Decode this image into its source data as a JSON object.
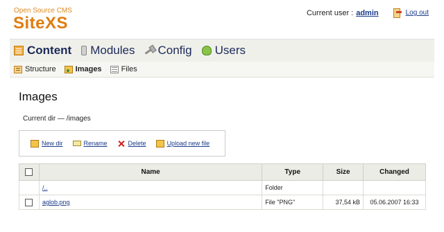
{
  "brand": {
    "tagline": "Open Source CMS",
    "name": "SiteXS"
  },
  "user": {
    "label": "Current user :",
    "name": "admin",
    "logout": "Log out"
  },
  "mainnav": [
    {
      "label": "Content",
      "icon": "content-icon",
      "active": true
    },
    {
      "label": "Modules",
      "icon": "modules-icon",
      "active": false
    },
    {
      "label": "Config",
      "icon": "config-icon",
      "active": false
    },
    {
      "label": "Users",
      "icon": "users-icon",
      "active": false
    }
  ],
  "subnav": [
    {
      "label": "Structure",
      "icon": "structure-icon",
      "active": false
    },
    {
      "label": "Images",
      "icon": "images-icon",
      "active": true
    },
    {
      "label": "Files",
      "icon": "files-icon",
      "active": false
    }
  ],
  "page": {
    "title": "Images",
    "current_dir": "Current dir — /images"
  },
  "toolbar": {
    "new_dir": "New dir",
    "rename": "Rename",
    "delete": "Delete",
    "upload": "Upload new file"
  },
  "table": {
    "headers": {
      "name": "Name",
      "type": "Type",
      "size": "Size",
      "changed": "Changed"
    },
    "rows": [
      {
        "name": "/..",
        "type": "Folder",
        "size": "",
        "changed": ""
      },
      {
        "name": "aglob.png",
        "type": "File \"PNG\"",
        "size": "37,54 kB",
        "changed": "05.06.2007 16:33"
      }
    ]
  },
  "colors": {
    "brand": "#e07b10",
    "link": "#1a3a8a",
    "nav_bg": "#f0f0ea"
  }
}
